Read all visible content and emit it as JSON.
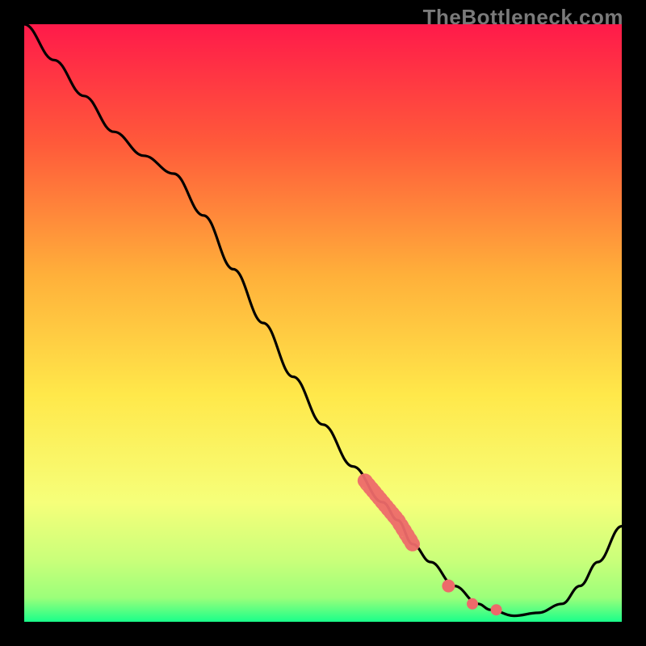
{
  "watermark": "TheBottleneck.com",
  "colors": {
    "frame": "#000000",
    "gradient_top": "#ff1a4a",
    "gradient_mid_upper": "#ff8a2a",
    "gradient_mid": "#ffe84a",
    "gradient_mid_lower": "#f6ff7a",
    "gradient_low": "#9bff7a",
    "gradient_bottom": "#1aff8a",
    "curve": "#000000",
    "marker_fill": "#ed6a6a",
    "marker_stroke": "#d94f4f"
  },
  "chart_data": {
    "type": "line",
    "title": "",
    "xlabel": "",
    "ylabel": "",
    "xlim": [
      0,
      100
    ],
    "ylim": [
      0,
      100
    ],
    "series": [
      {
        "name": "bottleneck-curve",
        "x": [
          0,
          5,
          10,
          15,
          20,
          25,
          30,
          35,
          40,
          45,
          50,
          55,
          60,
          62.5,
          65,
          68,
          72,
          76,
          78,
          82,
          86,
          90,
          93,
          96,
          100
        ],
        "y": [
          100,
          94,
          88,
          82,
          78,
          75,
          68,
          59,
          50,
          41,
          33,
          26,
          20,
          17,
          13,
          10,
          6,
          3,
          2,
          1,
          1.5,
          3,
          6,
          10,
          16
        ]
      }
    ],
    "highlight_segment": {
      "name": "recommended-range",
      "x_start": 57,
      "x_end": 65,
      "note": "thick salmon segment along curve"
    },
    "highlight_points": [
      {
        "x": 71,
        "y": 6
      },
      {
        "x": 75,
        "y": 3
      },
      {
        "x": 79,
        "y": 2
      }
    ]
  }
}
